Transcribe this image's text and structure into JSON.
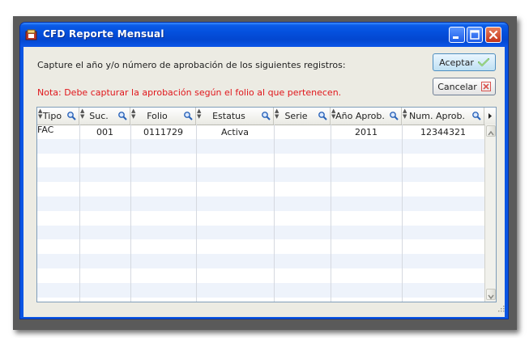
{
  "window": {
    "title": "CFD Reporte Mensual"
  },
  "prompt_text": "Capture el año y/o número de aprobación de los siguientes registros:",
  "note_text": "Nota: Debe capturar la aprobación según el folio al que pertenecen.",
  "buttons": {
    "accept_label": "Aceptar",
    "cancel_label": "Cancelar"
  },
  "table": {
    "columns": [
      "Tipo",
      "Suc.",
      "Folio",
      "Estatus",
      "Serie",
      "Año Aprob.",
      "Num. Aprob."
    ],
    "rows": [
      [
        "FAC",
        "001",
        "0111729",
        "Activa",
        "",
        "2011",
        "12344321"
      ]
    ]
  },
  "colors": {
    "title_bar": "#0a55e3",
    "note_text": "#e0171c",
    "row_alt": "#eef3fb"
  },
  "icons": {
    "accept": "check-icon",
    "cancel": "x-icon",
    "column_filter": "magnifier-icon"
  }
}
